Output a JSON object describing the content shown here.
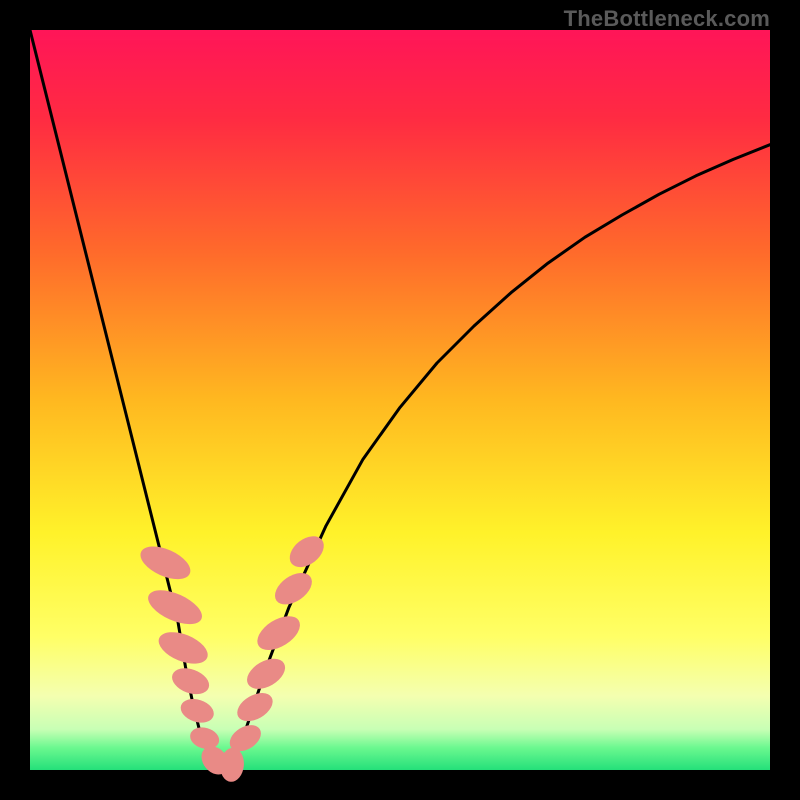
{
  "watermark": "TheBottleneck.com",
  "chart_data": {
    "type": "line",
    "title": "",
    "xlabel": "",
    "ylabel": "",
    "xlim": [
      0,
      100
    ],
    "ylim": [
      0,
      100
    ],
    "gradient_stops": [
      {
        "offset": 0,
        "color": "#ff1558"
      },
      {
        "offset": 0.12,
        "color": "#ff2b42"
      },
      {
        "offset": 0.3,
        "color": "#ff6a2b"
      },
      {
        "offset": 0.5,
        "color": "#ffb820"
      },
      {
        "offset": 0.68,
        "color": "#fff22a"
      },
      {
        "offset": 0.82,
        "color": "#ffff66"
      },
      {
        "offset": 0.9,
        "color": "#f4ffb0"
      },
      {
        "offset": 0.945,
        "color": "#c8ffb5"
      },
      {
        "offset": 0.97,
        "color": "#6bf88f"
      },
      {
        "offset": 1.0,
        "color": "#24e07a"
      }
    ],
    "series": [
      {
        "name": "left-curve",
        "x": [
          0,
          2,
          4,
          6,
          8,
          10,
          12,
          14,
          16,
          18,
          20,
          21,
          22,
          23,
          24,
          25,
          26
        ],
        "y": [
          100,
          92,
          84,
          76,
          68,
          60,
          52,
          44,
          36,
          28,
          20,
          14,
          9,
          5,
          2.5,
          1,
          0
        ]
      },
      {
        "name": "right-curve",
        "x": [
          26,
          27,
          28,
          29,
          30,
          32,
          35,
          40,
          45,
          50,
          55,
          60,
          65,
          70,
          75,
          80,
          85,
          90,
          95,
          100
        ],
        "y": [
          0,
          1,
          2.8,
          5,
          8,
          14,
          22,
          33,
          42,
          49,
          55,
          60,
          64.5,
          68.5,
          72,
          75,
          77.8,
          80.3,
          82.5,
          84.5
        ]
      }
    ],
    "markers": {
      "name": "salmon-pills",
      "color": "#e98a86",
      "items": [
        {
          "cx": 18.3,
          "cy": 28.0,
          "rx": 1.8,
          "ry": 3.6,
          "rot": -66
        },
        {
          "cx": 19.6,
          "cy": 22.0,
          "rx": 1.8,
          "ry": 3.9,
          "rot": -66
        },
        {
          "cx": 20.7,
          "cy": 16.5,
          "rx": 1.8,
          "ry": 3.5,
          "rot": -68
        },
        {
          "cx": 21.7,
          "cy": 12.0,
          "rx": 1.6,
          "ry": 2.6,
          "rot": -70
        },
        {
          "cx": 22.6,
          "cy": 8.0,
          "rx": 1.5,
          "ry": 2.3,
          "rot": -72
        },
        {
          "cx": 23.6,
          "cy": 4.3,
          "rx": 1.4,
          "ry": 2.0,
          "rot": -74
        },
        {
          "cx": 25.0,
          "cy": 1.3,
          "rx": 1.6,
          "ry": 2.1,
          "rot": -40
        },
        {
          "cx": 27.3,
          "cy": 0.7,
          "rx": 1.6,
          "ry": 2.3,
          "rot": 5
        },
        {
          "cx": 29.1,
          "cy": 4.3,
          "rx": 1.5,
          "ry": 2.3,
          "rot": 58
        },
        {
          "cx": 30.4,
          "cy": 8.5,
          "rx": 1.6,
          "ry": 2.6,
          "rot": 60
        },
        {
          "cx": 31.9,
          "cy": 13.0,
          "rx": 1.7,
          "ry": 2.8,
          "rot": 60
        },
        {
          "cx": 33.6,
          "cy": 18.5,
          "rx": 1.8,
          "ry": 3.2,
          "rot": 58
        },
        {
          "cx": 35.6,
          "cy": 24.5,
          "rx": 1.7,
          "ry": 2.8,
          "rot": 55
        },
        {
          "cx": 37.4,
          "cy": 29.5,
          "rx": 1.7,
          "ry": 2.6,
          "rot": 52
        }
      ]
    }
  }
}
